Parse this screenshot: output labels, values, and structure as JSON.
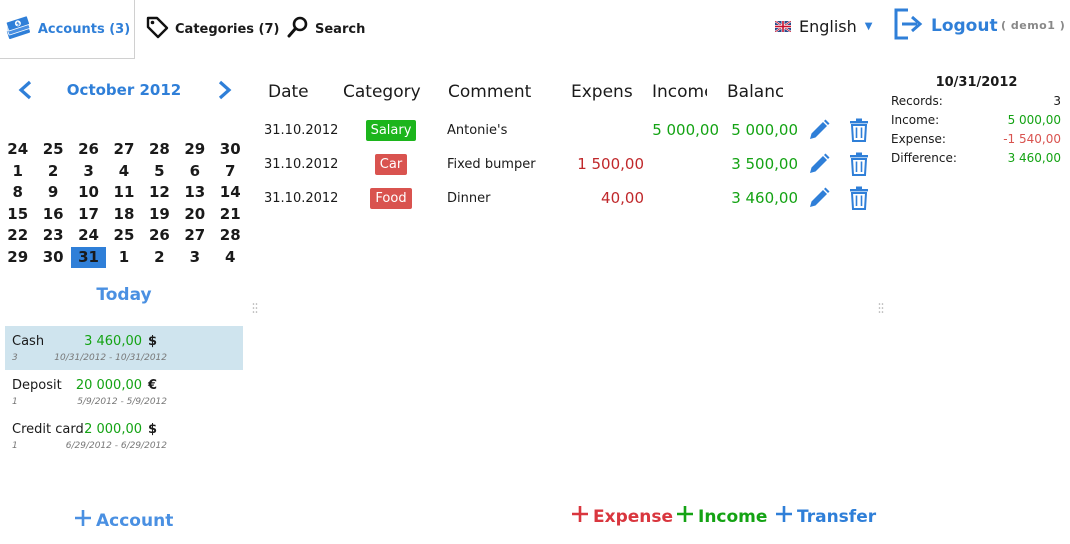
{
  "topbar": {
    "tabs": [
      {
        "label": "Accounts (3)",
        "icon": "money-stack-icon"
      },
      {
        "label": "Categories (7)",
        "icon": "tag-icon"
      },
      {
        "label": "Search",
        "icon": "search-icon"
      }
    ],
    "language": "English",
    "logout_label": "Logout",
    "user": "( demo1 )"
  },
  "calendar": {
    "month_label": "October 2012",
    "weeks": [
      [
        "24",
        "25",
        "26",
        "27",
        "28",
        "29",
        "30"
      ],
      [
        "1",
        "2",
        "3",
        "4",
        "5",
        "6",
        "7"
      ],
      [
        "8",
        "9",
        "10",
        "11",
        "12",
        "13",
        "14"
      ],
      [
        "15",
        "16",
        "17",
        "18",
        "19",
        "20",
        "21"
      ],
      [
        "22",
        "23",
        "24",
        "25",
        "26",
        "27",
        "28"
      ],
      [
        "29",
        "30",
        "31",
        "1",
        "2",
        "3",
        "4"
      ]
    ],
    "selected_day": "31",
    "today_label": "Today"
  },
  "accounts": [
    {
      "name": "Cash",
      "balance": "3 460,00",
      "currency": "$",
      "count": "3",
      "range": "10/31/2012 - 10/31/2012",
      "active": true
    },
    {
      "name": "Deposit",
      "balance": "20 000,00",
      "currency": "€",
      "count": "1",
      "range": "5/9/2012 - 5/9/2012",
      "active": false
    },
    {
      "name": "Credit card",
      "balance": "2 000,00",
      "currency": "$",
      "count": "1",
      "range": "6/29/2012 - 6/29/2012",
      "active": false
    }
  ],
  "add_account_label": "Account",
  "table": {
    "headers": {
      "date": "Date",
      "category": "Category",
      "comment": "Comment",
      "expense": "Expense",
      "income": "Income",
      "balance": "Balance"
    },
    "rows": [
      {
        "date": "31.10.2012",
        "category": "Salary",
        "category_color": "#1cb51c",
        "comment": "Antonie's",
        "expense": "",
        "income": "5 000,00",
        "balance": "5 000,00"
      },
      {
        "date": "31.10.2012",
        "category": "Car",
        "category_color": "#d9534f",
        "comment": "Fixed bumper",
        "expense": "1 500,00",
        "income": "",
        "balance": "3 500,00"
      },
      {
        "date": "31.10.2012",
        "category": "Food",
        "category_color": "#d9534f",
        "comment": "Dinner",
        "expense": "40,00",
        "income": "",
        "balance": "3 460,00"
      }
    ]
  },
  "summary": {
    "date": "10/31/2012",
    "rows": [
      {
        "label": "Records:",
        "value": "3"
      },
      {
        "label": "Income:",
        "value": "5 000,00"
      },
      {
        "label": "Expense:",
        "value": "-1 540,00"
      },
      {
        "label": "Difference:",
        "value": "3 460,00"
      }
    ]
  },
  "actions": {
    "expense": "Expense",
    "income": "Income",
    "transfer": "Transfer"
  },
  "colors": {
    "accent": "#2f7fd8",
    "income": "#14a314",
    "expense": "#c0282b",
    "active_account": "#cfe4ee"
  }
}
